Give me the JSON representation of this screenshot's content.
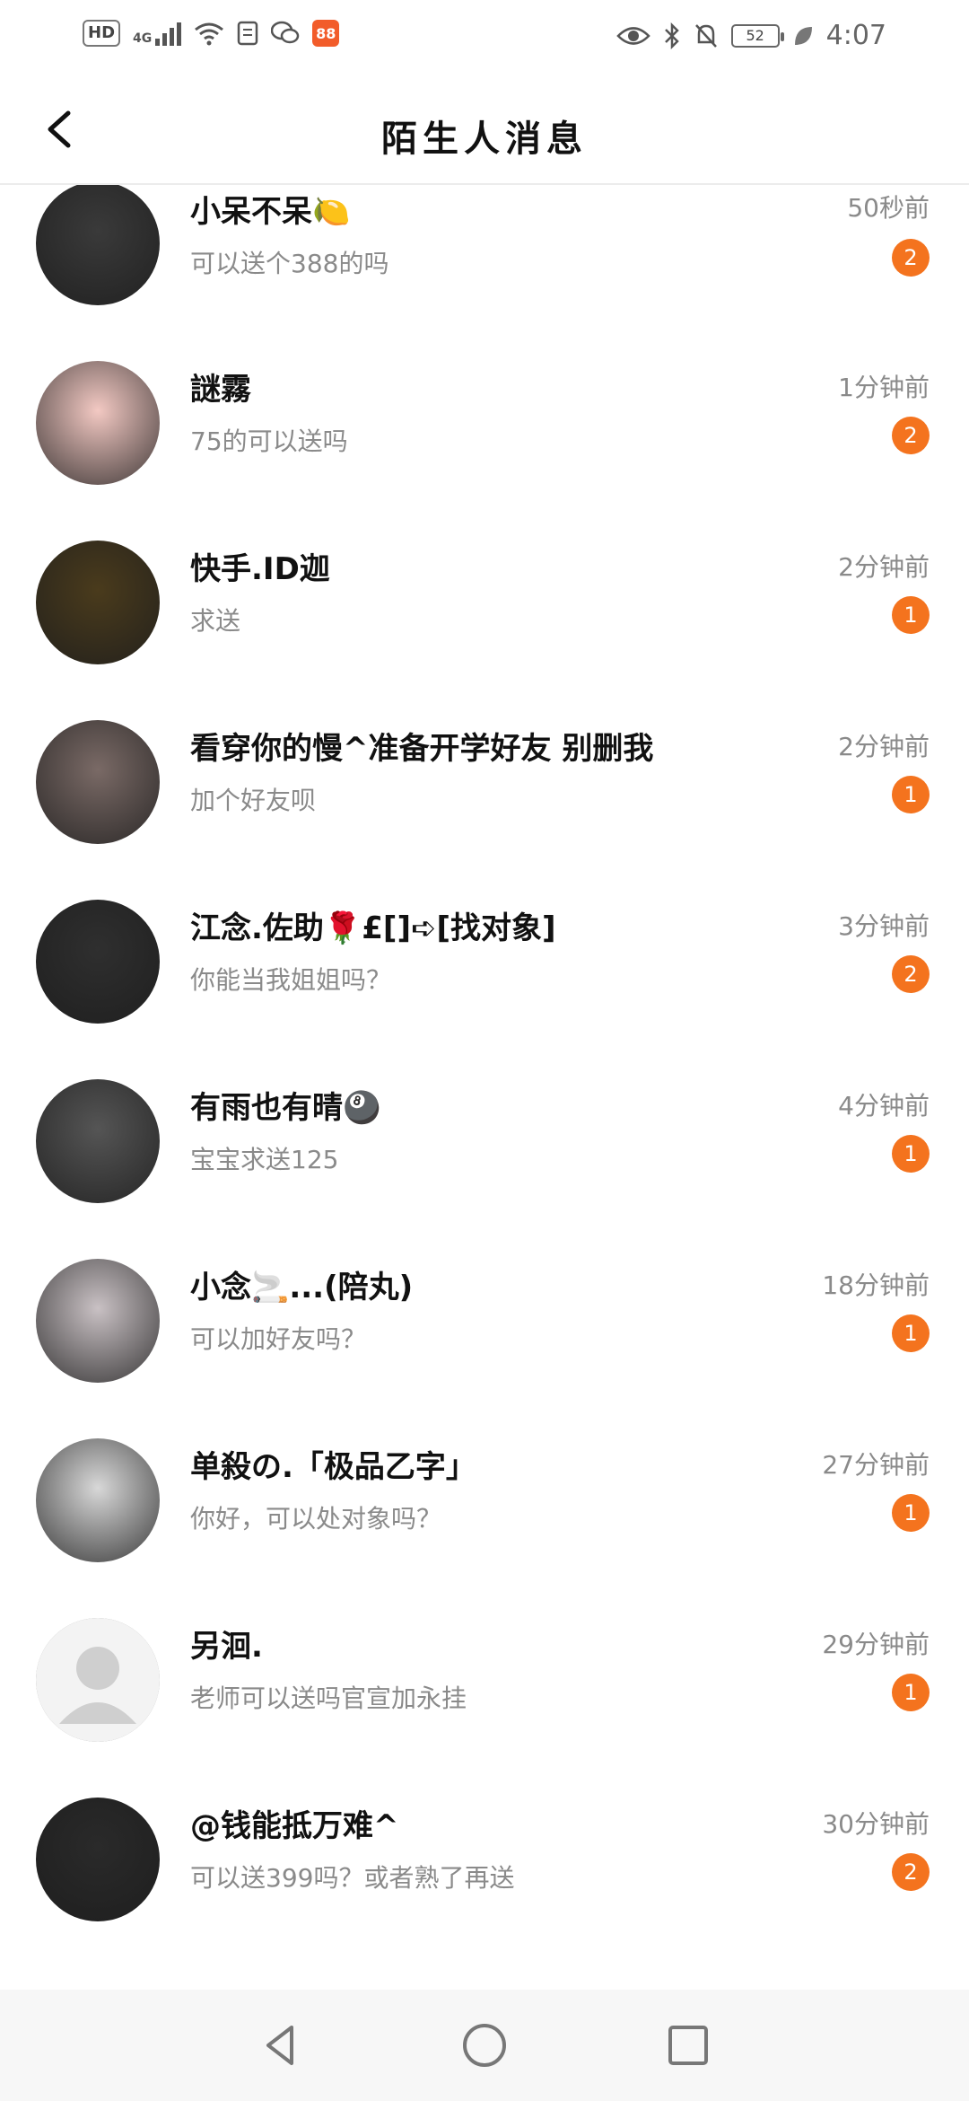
{
  "status_bar": {
    "left_icons": [
      "hd-icon",
      "signal-4g-icon",
      "wifi-icon",
      "doc-icon",
      "wechat-icon",
      "app-icon"
    ],
    "hd_label": "HD",
    "network_label": "4G",
    "app_label": "88",
    "battery_level": "52",
    "time": "4:07",
    "right_icons": [
      "eye-icon",
      "bluetooth-icon",
      "bell-off-icon",
      "battery-icon",
      "leaf-icon"
    ]
  },
  "header": {
    "title": "陌生人消息",
    "back_icon": "chevron-left-icon"
  },
  "colors": {
    "badge": "#f4731e",
    "secondary_text": "#8a8a8a",
    "divider": "#ececec"
  },
  "conversations": [
    {
      "name": "小呆不呆🍋",
      "message": "可以送个388的吗",
      "time": "50秒前",
      "unread": "2",
      "avatar_color": "#3a3a3a"
    },
    {
      "name": "謎霧",
      "message": "75的可以送吗",
      "time": "1分钟前",
      "unread": "2",
      "avatar_color": "#f3c9c3"
    },
    {
      "name": "快手.ID迦",
      "message": "求送",
      "time": "2分钟前",
      "unread": "1",
      "avatar_color": "#4a3b1c"
    },
    {
      "name": "看穿你的慢^准备开学好友 别删我",
      "message": "加个好友呗",
      "time": "2分钟前",
      "unread": "1",
      "avatar_color": "#7a6a66"
    },
    {
      "name": "江念.佐助🌹£[]➪[找对象]",
      "message": "你能当我姐姐吗？",
      "time": "3分钟前",
      "unread": "2",
      "avatar_color": "#2f2f2f"
    },
    {
      "name": "有雨也有晴🎱",
      "message": "宝宝求送125",
      "time": "4分钟前",
      "unread": "1",
      "avatar_color": "#555555"
    },
    {
      "name": "小念🚬...(陪丸)",
      "message": "可以加好友吗？",
      "time": "18分钟前",
      "unread": "1",
      "avatar_color": "#c9c1c4"
    },
    {
      "name": "单殺の.「极品乙字」",
      "message": "你好，可以处对象吗？",
      "time": "27分钟前",
      "unread": "1",
      "avatar_color": "#d8d8d8"
    },
    {
      "name": "另洄.",
      "message": "老师可以送吗官宣加永挂",
      "time": "29分钟前",
      "unread": "1",
      "avatar_color": "#efefef"
    },
    {
      "name": "@钱能抵万难^",
      "message": "可以送399吗？或者熟了再送",
      "time": "30分钟前",
      "unread": "2",
      "avatar_color": "#2a2a2a"
    }
  ],
  "nav_bar": {
    "back": "triangle-back-icon",
    "home": "circle-home-icon",
    "recents": "square-recents-icon"
  }
}
